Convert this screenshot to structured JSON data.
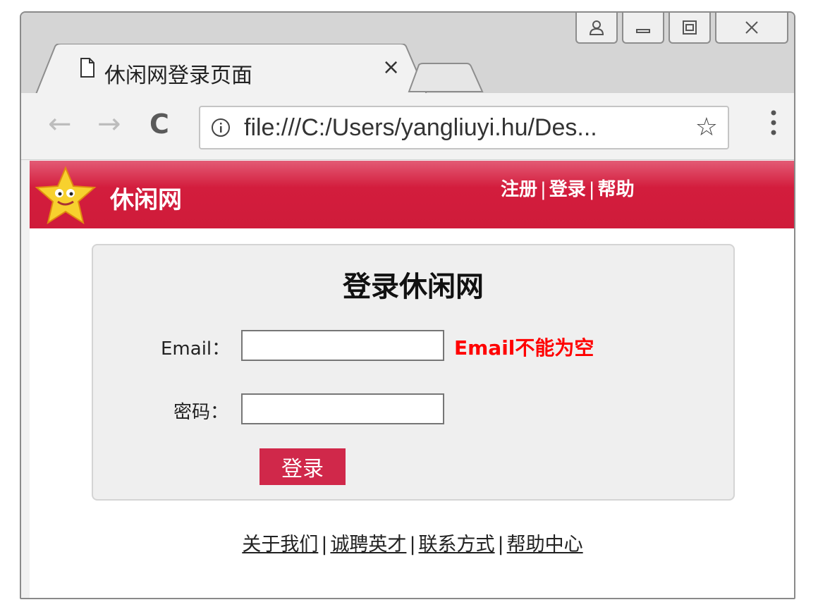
{
  "browser": {
    "tab_title": "休闲网登录页面",
    "tab_close": "×",
    "url": "file:///C:/Users/yangliuyi.hu/Des...",
    "back": "←",
    "forward": "→",
    "reload": "C",
    "star": "☆"
  },
  "header": {
    "site_name": "休闲网",
    "links": [
      "注册",
      "登录",
      "帮助"
    ],
    "separator": "|"
  },
  "login": {
    "title": "登录休闲网",
    "email_label": "Email：",
    "email_value": "",
    "email_error": "Email不能为空",
    "password_label": "密码：",
    "password_value": "",
    "submit_label": "登录"
  },
  "footer": {
    "links": [
      "关于我们",
      "诚聘英才",
      "联系方式",
      "帮助中心"
    ],
    "separator": "|"
  },
  "colors": {
    "header_red": "#d31d3d",
    "error_red": "#ff0000",
    "button_red": "#d0284a"
  }
}
